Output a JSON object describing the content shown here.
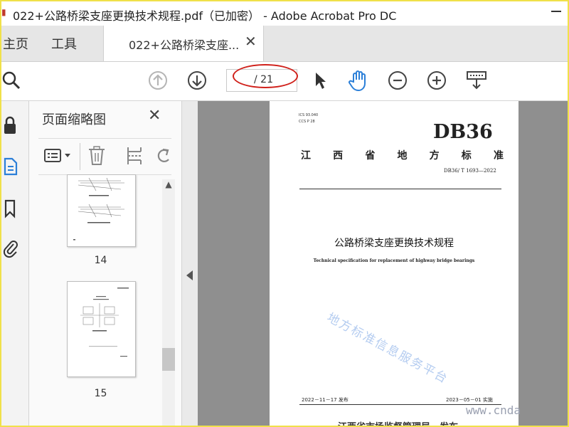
{
  "window": {
    "title": "022+公路桥梁支座更换技术规程.pdf（已加密） - Adobe Acrobat Pro DC"
  },
  "tabs": {
    "home_label": "主页",
    "tools_label": "工具",
    "doc_label": "022+公路桥梁支座..."
  },
  "toolbar": {
    "page_total": "/ 21",
    "icons": [
      "search-icon",
      "arrow-up-circle-icon",
      "arrow-down-circle-icon",
      "select-pointer-icon",
      "hand-icon",
      "zoom-out-icon",
      "zoom-in-icon",
      "keyboard-icon"
    ]
  },
  "panel": {
    "title": "页面缩略图",
    "thumbnails": [
      {
        "page": "14"
      },
      {
        "page": "15"
      }
    ]
  },
  "document": {
    "ics": "ICS 93.040",
    "ccs": "CCS P 28",
    "logo": "DB36",
    "province_chars": [
      "江",
      "西",
      "省",
      "地",
      "方",
      "标",
      "准"
    ],
    "standard_no": "DB36/ T 1693—2022",
    "title_cn": "公路桥梁支座更换技术规程",
    "title_en": "Technical specification for replacement of highway bridge bearings",
    "publish_date": "2022－11－17 发布",
    "implement_date": "2023－05－01 实施",
    "issuer": "江西省市场监督管理局　发布"
  },
  "watermark": {
    "text": "地方标准信息服务平台",
    "site": "www.cnda"
  },
  "colors": {
    "frame": "#f0e14a",
    "annotation_ellipse": "#d0201a",
    "hand_active": "#2b7fd8"
  }
}
